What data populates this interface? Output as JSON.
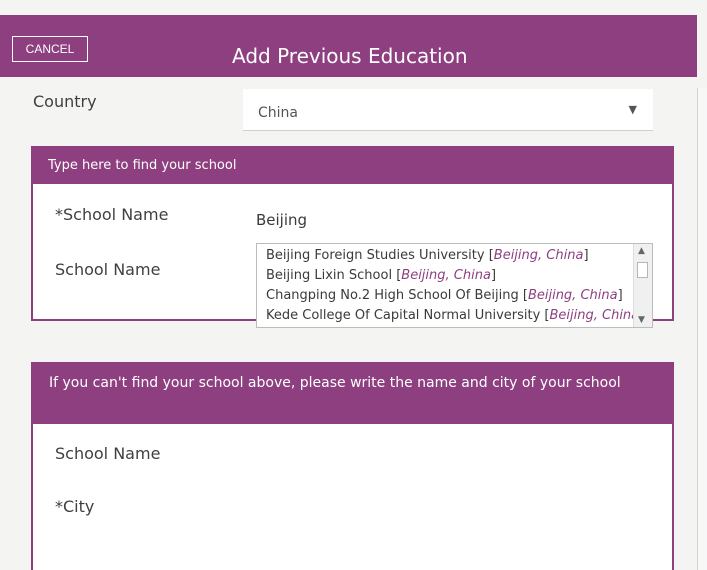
{
  "header": {
    "cancel_label": "CANCEL",
    "title": "Add Previous Education",
    "color": "#8e3f80"
  },
  "country": {
    "label": "Country",
    "value": "China"
  },
  "find_school": {
    "heading": "Type here to find your school",
    "required_label": "*School Name",
    "input_value": "Beijing",
    "second_label": "School Name",
    "results": [
      {
        "name": "Beijing Foreign Studies University [",
        "location": "Beijing, China",
        "close": "]"
      },
      {
        "name": "Beijing Lixin School [",
        "location": "Beijing, China",
        "close": "]"
      },
      {
        "name": "Changping No.2 High School Of Beijing [",
        "location": "Beijing, China",
        "close": "]"
      },
      {
        "name": "Kede College Of Capital Normal University [",
        "location": "Beijing, China",
        "close": "]"
      }
    ]
  },
  "manual_entry": {
    "heading": "If you can't find your school above, please write the name and city of your school",
    "school_label": "School Name",
    "city_label": "*City",
    "school_value": "",
    "city_value": ""
  },
  "icons": {
    "select_caret": "▼",
    "scroll_up": "▲",
    "scroll_down": "▼"
  }
}
